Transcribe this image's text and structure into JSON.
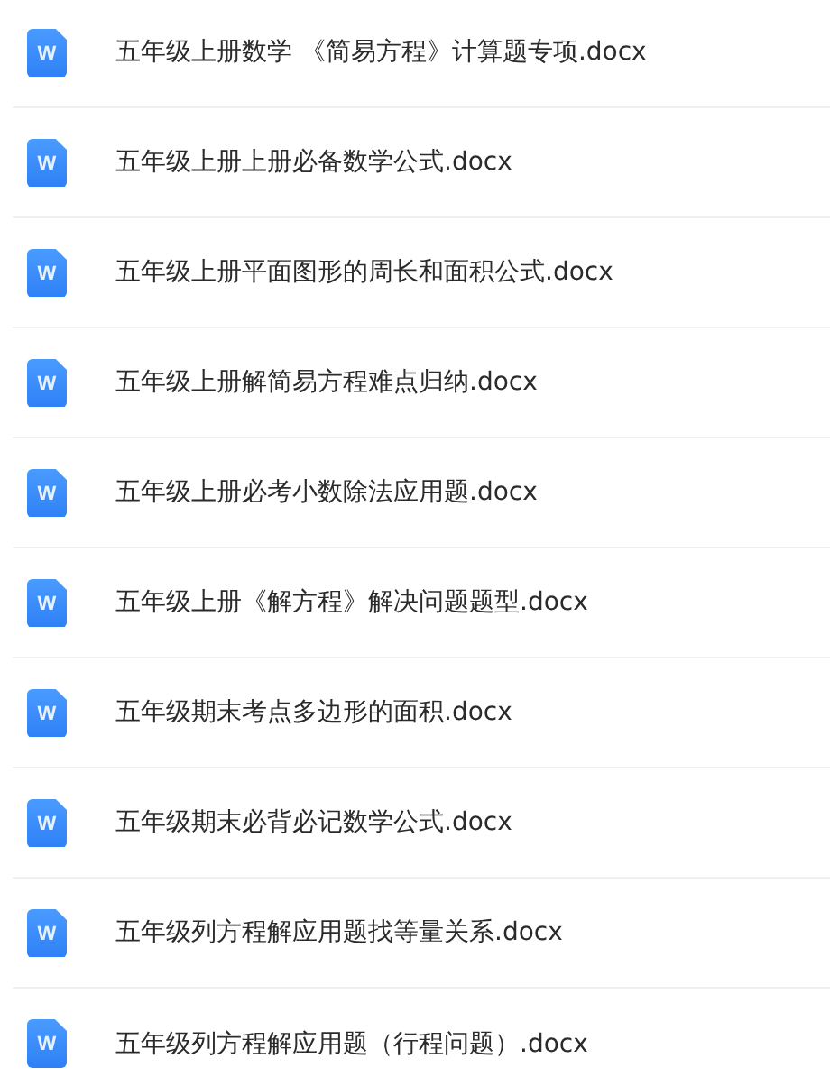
{
  "files": [
    {
      "icon_letter": "W",
      "name": "五年级上册数学 《简易方程》计算题专项.docx"
    },
    {
      "icon_letter": "W",
      "name": "五年级上册上册必备数学公式.docx"
    },
    {
      "icon_letter": "W",
      "name": "五年级上册平面图形的周长和面积公式.docx"
    },
    {
      "icon_letter": "W",
      "name": "五年级上册解简易方程难点归纳.docx"
    },
    {
      "icon_letter": "W",
      "name": "五年级上册必考小数除法应用题.docx"
    },
    {
      "icon_letter": "W",
      "name": "五年级上册《解方程》解决问题题型.docx"
    },
    {
      "icon_letter": "W",
      "name": "五年级期末考点多边形的面积.docx"
    },
    {
      "icon_letter": "W",
      "name": "五年级期末必背必记数学公式.docx"
    },
    {
      "icon_letter": "W",
      "name": "五年级列方程解应用题找等量关系.docx"
    },
    {
      "icon_letter": "W",
      "name": "五年级列方程解应用题（行程问题）.docx"
    }
  ]
}
